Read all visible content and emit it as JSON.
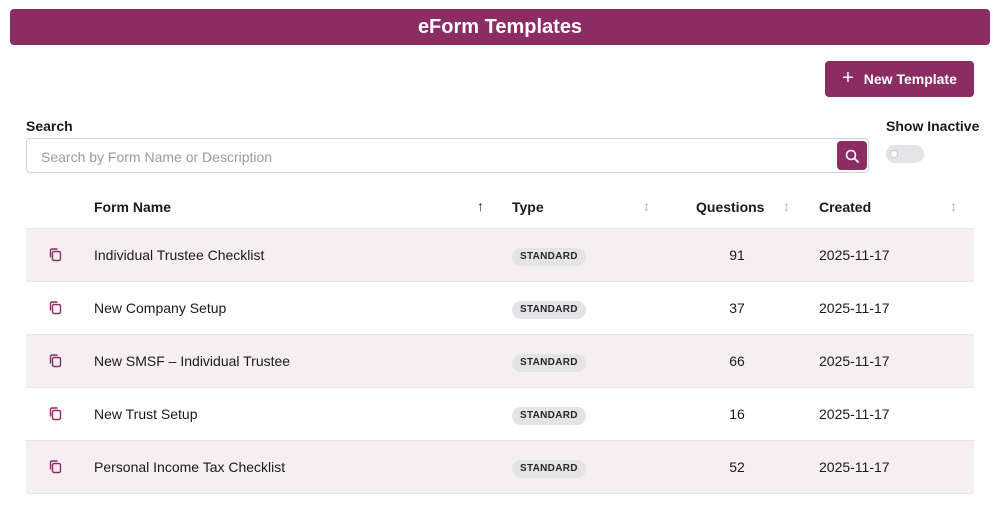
{
  "header": {
    "title": "eForm Templates"
  },
  "actions": {
    "new_template_label": "New Template"
  },
  "search": {
    "label": "Search",
    "placeholder": "Search by Form Name or Description",
    "value": ""
  },
  "filters": {
    "show_inactive_label": "Show Inactive",
    "show_inactive_on": false
  },
  "table": {
    "columns": [
      {
        "label": "Form Name",
        "sort": "asc"
      },
      {
        "label": "Type",
        "sort": "none"
      },
      {
        "label": "Questions",
        "sort": "none"
      },
      {
        "label": "Created",
        "sort": "none"
      }
    ],
    "rows": [
      {
        "name": "Individual Trustee Checklist",
        "type": "STANDARD",
        "questions": "91",
        "created": "2025-11-17"
      },
      {
        "name": "New Company Setup",
        "type": "STANDARD",
        "questions": "37",
        "created": "2025-11-17"
      },
      {
        "name": "New SMSF – Individual Trustee",
        "type": "STANDARD",
        "questions": "66",
        "created": "2025-11-17"
      },
      {
        "name": "New Trust Setup",
        "type": "STANDARD",
        "questions": "16",
        "created": "2025-11-17"
      },
      {
        "name": "Personal Income Tax Checklist",
        "type": "STANDARD",
        "questions": "52",
        "created": "2025-11-17"
      }
    ]
  },
  "icons": {
    "plus": "plus-icon",
    "search": "search-icon",
    "copy": "copy-icon",
    "sort_asc": "arrow-up-icon",
    "sort_none": "sort-updown-icon"
  },
  "colors": {
    "brand": "#8b2c63",
    "row_alt": "#f5eff2",
    "badge_bg": "#e4e4e7"
  }
}
